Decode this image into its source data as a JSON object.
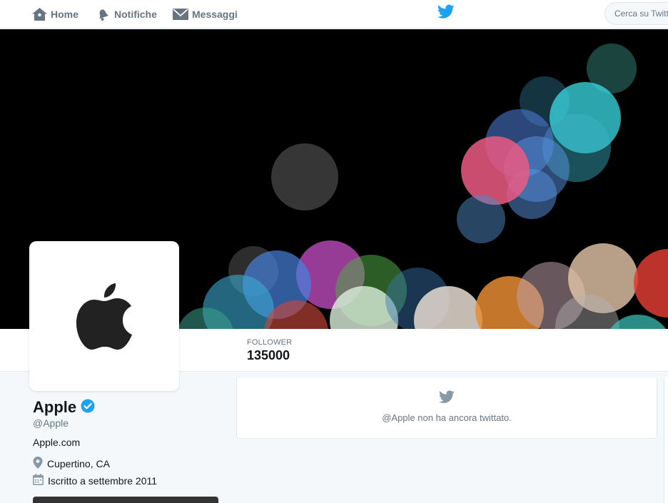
{
  "nav": {
    "home": "Home",
    "notifications": "Notifiche",
    "messages": "Messaggi",
    "search_placeholder": "Cerca su Twitter"
  },
  "profile": {
    "name": "Apple",
    "handle": "@Apple",
    "website": "Apple.com",
    "location": "Cupertino, CA",
    "joined": "Iscritto a settembre 2011",
    "verified": true
  },
  "stats": {
    "followers_label": "FOLLOWER",
    "followers_value": "135000"
  },
  "timeline": {
    "empty_message": "@Apple non ha ancora twittato."
  },
  "icons": {
    "home": "home-icon",
    "notifications": "bell-icon",
    "messages": "envelope-icon",
    "logo": "twitter-bird-icon",
    "verified": "verified-badge-icon",
    "location": "location-pin-icon",
    "calendar": "calendar-icon",
    "avatar": "apple-logo-icon"
  },
  "colors": {
    "twitter_blue": "#1da1f2",
    "verified": "#1da1f2",
    "nav_text": "#66757f",
    "muted": "#657786",
    "banner_bg": "#000000"
  }
}
